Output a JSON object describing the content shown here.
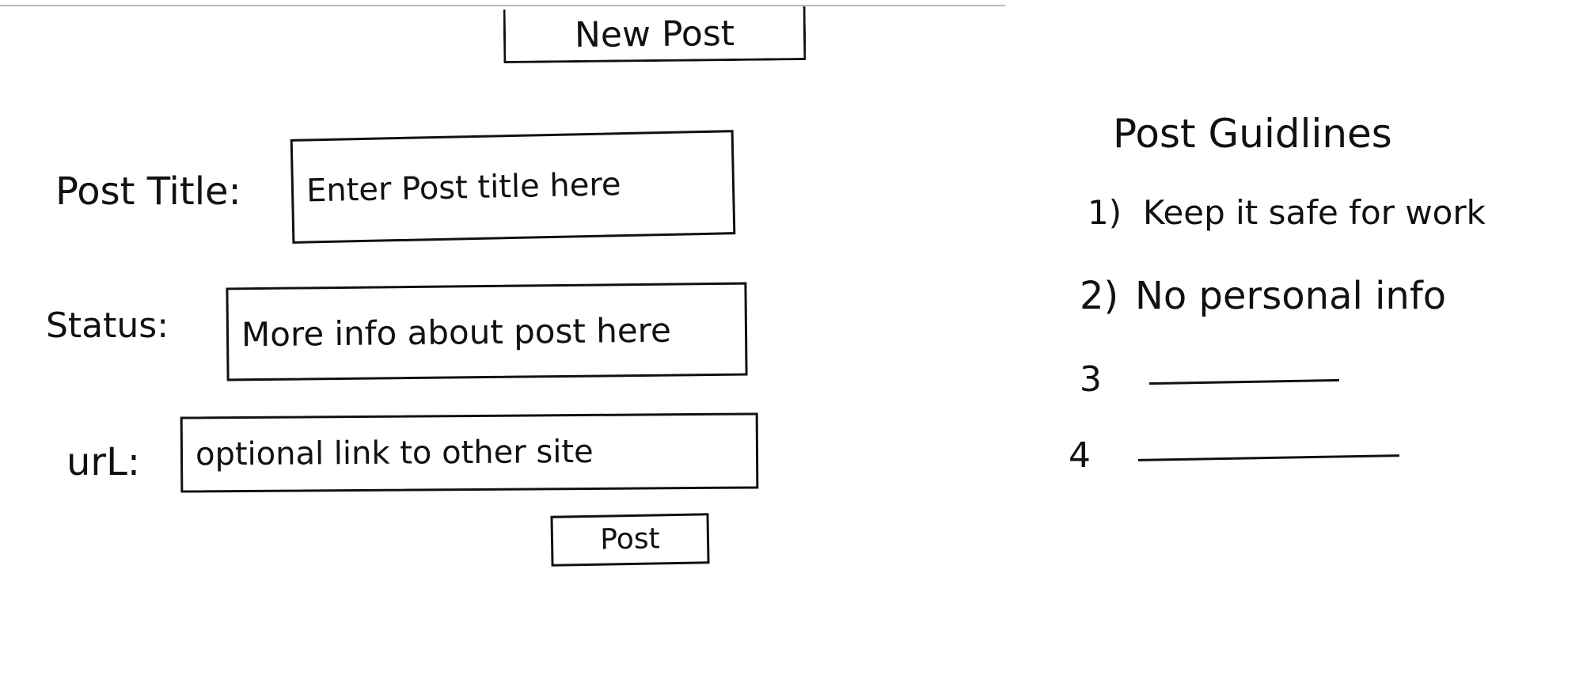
{
  "header": {
    "new_post_label": "New Post"
  },
  "form": {
    "title_label": "Post Title:",
    "title_placeholder": "Enter Post title here",
    "status_label": "Status:",
    "status_placeholder": "More info about post here",
    "url_label": "urL:",
    "url_placeholder": "optional link to other site",
    "submit_label": "Post"
  },
  "guidelines": {
    "title": "Post Guidlines",
    "items": [
      {
        "number": "1)",
        "text": "Keep it safe for work"
      },
      {
        "number": "2)",
        "text": "No personal info"
      },
      {
        "number": "3",
        "text": ""
      },
      {
        "number": "4",
        "text": ""
      }
    ]
  }
}
